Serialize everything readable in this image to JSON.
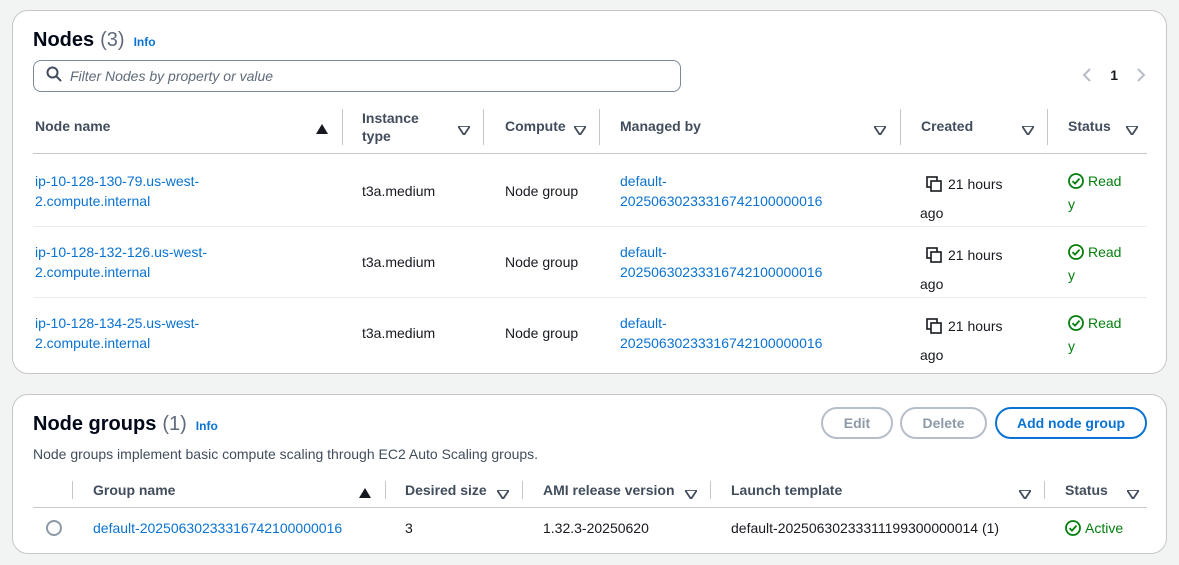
{
  "nodes": {
    "title": "Nodes",
    "count": "(3)",
    "info": "Info",
    "search_placeholder": "Filter Nodes by property or value",
    "page": "1",
    "columns": {
      "node_name": "Node name",
      "instance_type_1": "Instance",
      "instance_type_2": "type",
      "compute": "Compute",
      "managed_by": "Managed by",
      "created": "Created",
      "status": "Status"
    },
    "rows": [
      {
        "name_1": "ip-10-128-130-79.us-west-",
        "name_2": "2.compute.internal",
        "instance_type": "t3a.medium",
        "compute": "Node group",
        "managed_1": "default-",
        "managed_2": "20250630233316742100000016",
        "created_1": "21 hours",
        "created_2": "ago",
        "status_1": "Read",
        "status_2": "y"
      },
      {
        "name_1": "ip-10-128-132-126.us-west-",
        "name_2": "2.compute.internal",
        "instance_type": "t3a.medium",
        "compute": "Node group",
        "managed_1": "default-",
        "managed_2": "20250630233316742100000016",
        "created_1": "21 hours",
        "created_2": "ago",
        "status_1": "Read",
        "status_2": "y"
      },
      {
        "name_1": "ip-10-128-134-25.us-west-",
        "name_2": "2.compute.internal",
        "instance_type": "t3a.medium",
        "compute": "Node group",
        "managed_1": "default-",
        "managed_2": "20250630233316742100000016",
        "created_1": "21 hours",
        "created_2": "ago",
        "status_1": "Read",
        "status_2": "y"
      }
    ]
  },
  "node_groups": {
    "title": "Node groups",
    "count": "(1)",
    "info": "Info",
    "description": "Node groups implement basic compute scaling through EC2 Auto Scaling groups.",
    "buttons": {
      "edit": "Edit",
      "delete": "Delete",
      "add": "Add node group"
    },
    "columns": {
      "group_name": "Group name",
      "desired_size": "Desired size",
      "ami_release": "AMI release version",
      "launch_template": "Launch template",
      "status": "Status"
    },
    "rows": [
      {
        "group_name": "default-20250630233316742100000016",
        "desired_size": "3",
        "ami_release": "1.32.3-20250620",
        "launch_template": "default-20250630233311199300000014 (1)",
        "status": "Active"
      }
    ]
  },
  "colors": {
    "link": "#0972d3",
    "success": "#037f0c",
    "text": "#16191f",
    "header_text": "#414d5c"
  }
}
